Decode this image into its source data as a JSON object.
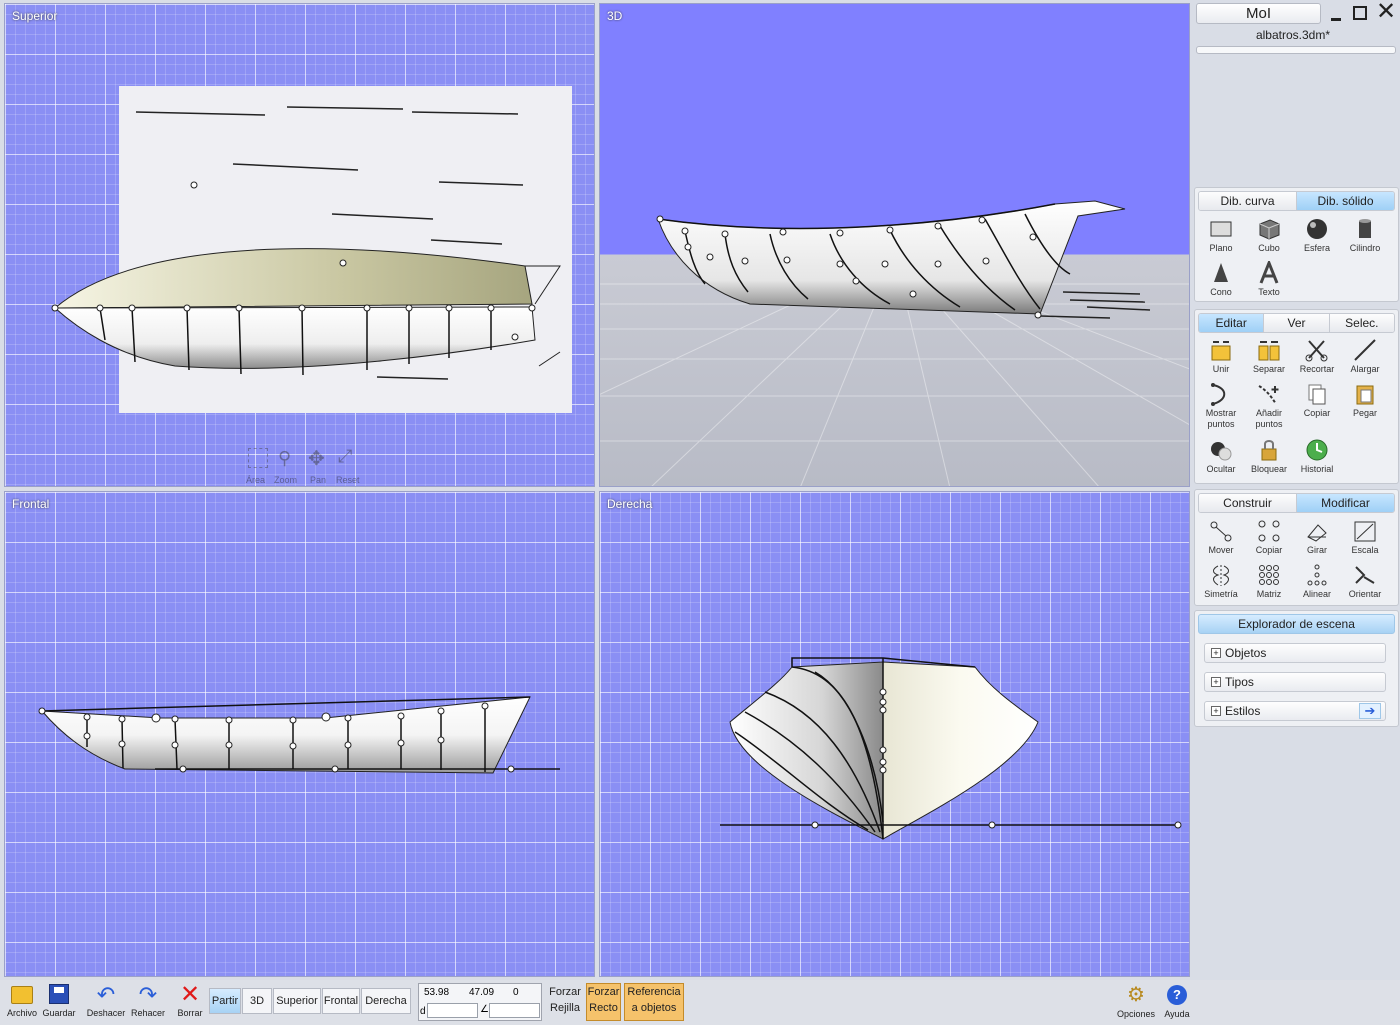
{
  "viewports": {
    "top": {
      "title": "Superior"
    },
    "persp": {
      "title": "3D"
    },
    "front": {
      "title": "Frontal"
    },
    "right": {
      "title": "Derecha"
    }
  },
  "nav_overlay": {
    "area": "Área",
    "zoom": "Zoom",
    "pan": "Pan",
    "reset": "Reset"
  },
  "app": {
    "name": "MoI",
    "file": "albatros.3dm*"
  },
  "draw_tabs": [
    "Dib. curva",
    "Dib. sólido"
  ],
  "solid_tools": [
    "Plano",
    "Cubo",
    "Esfera",
    "Cilindro",
    "Cono",
    "Texto"
  ],
  "edit_tabs": [
    "Editar",
    "Ver",
    "Selec."
  ],
  "edit_tools": [
    "Unir",
    "Separar",
    "Recortar",
    "Alargar",
    "Mostrar puntos",
    "Añadir puntos",
    "Copiar",
    "Pegar",
    "Ocultar",
    "Bloquear",
    "Historial"
  ],
  "xform_tabs": [
    "Construir",
    "Modificar"
  ],
  "xform_tools": [
    "Mover",
    "Copiar",
    "Girar",
    "Escala",
    "Simetría",
    "Matriz",
    "Alinear",
    "Orientar"
  ],
  "explorer": {
    "title": "Explorador de escena",
    "items": [
      "Objetos",
      "Tipos",
      "Estilos"
    ]
  },
  "bottom": {
    "file_open": "Archivo",
    "file_save": "Guardar",
    "undo": "Deshacer",
    "redo": "Rehacer",
    "delete": "Borrar",
    "views": [
      "Partir",
      "3D",
      "Superior",
      "Frontal",
      "Derecha"
    ],
    "coords": {
      "x": "53.98",
      "y": "47.09",
      "z": "0"
    },
    "dist_label": "d",
    "snap_grid": [
      "Forzar",
      "Rejilla"
    ],
    "snap_straight": [
      "Forzar",
      "Recto"
    ],
    "snap_obj": [
      "Referencia",
      "a objetos"
    ],
    "options": "Opciones",
    "help": "Ayuda"
  },
  "colors": {
    "viewport_bg": "#8a8ff4",
    "panel_bg": "#eef0f4",
    "tab_active": "#9fd0f6",
    "snap_active": "#f5c26b"
  }
}
